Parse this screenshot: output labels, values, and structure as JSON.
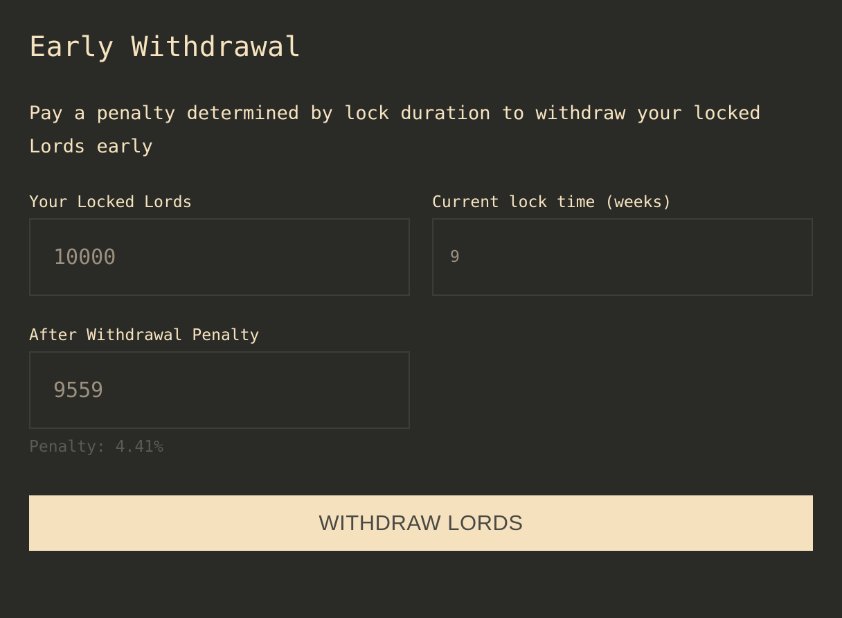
{
  "header": {
    "title": "Early Withdrawal",
    "description": "Pay a penalty determined by lock duration to withdraw your locked Lords early"
  },
  "fields": {
    "locked_lords": {
      "label": "Your Locked Lords",
      "value": "10000"
    },
    "lock_time": {
      "label": "Current lock time (weeks)",
      "value": "9"
    },
    "after_penalty": {
      "label": "After Withdrawal Penalty",
      "value": "9559"
    }
  },
  "penalty": {
    "text": "Penalty: 4.41%"
  },
  "actions": {
    "withdraw_label": "WITHDRAW LORDS"
  },
  "colors": {
    "background": "#2a2a26",
    "text": "#f6e3bf",
    "button_bg": "#f6e1bf",
    "button_text": "#4a4a45",
    "muted": "#5b5b55"
  }
}
